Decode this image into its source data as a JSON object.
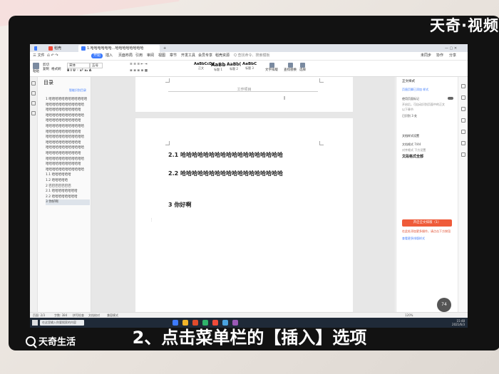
{
  "watermark": "天奇·视频",
  "caption": "2、点击菜单栏的【插入】选项",
  "logo_text": "天奇生活",
  "tabs": [
    {
      "label": "稻壳"
    },
    {
      "label": "1.哈哈哈哈哈哈...哈哈哈哈哈哈哈哈"
    }
  ],
  "menu": [
    "三 文件",
    "开始",
    "插入",
    "页面布局",
    "引用",
    "审阅",
    "视图",
    "章节",
    "开发工具",
    "会员专享",
    "稻壳资源",
    "Q 查找命令、搜索模板"
  ],
  "menu_right": [
    "未同步",
    "协作",
    "分享"
  ],
  "ribbon": {
    "paste": "粘贴",
    "cut": "剪切",
    "copy": "复制",
    "format_painter": "格式刷",
    "font": "宋体",
    "size": "五号",
    "styles": [
      {
        "sample": "AaBbCcDd",
        "name": "正文"
      },
      {
        "sample": "AaBb",
        "name": "标题 1"
      },
      {
        "sample": "AaBb(",
        "name": "标题 2"
      },
      {
        "sample": "AaBbC",
        "name": "标题 3"
      }
    ],
    "text_tools": "文字排版",
    "find_replace": "查找替换",
    "select": "选择"
  },
  "nav": {
    "title": "目录",
    "smart": "智能识别目录",
    "items": [
      "1 哈哈哈哈哈哈哈哈哈哈哈哈",
      "哈哈哈哈哈哈哈哈哈哈哈哈",
      "哈哈哈哈哈哈哈哈哈哈哈",
      "哈哈哈哈哈哈哈哈哈哈哈哈",
      "哈哈哈哈哈哈哈哈哈哈哈",
      "哈哈哈哈哈哈哈哈哈哈哈哈",
      "哈哈哈哈哈哈哈哈哈哈哈",
      "哈哈哈哈哈哈哈哈哈哈哈哈",
      "哈哈哈哈哈哈哈哈哈哈哈",
      "哈哈哈哈哈哈哈哈哈哈哈哈",
      "哈哈哈哈哈哈哈哈哈哈哈",
      "哈哈哈哈哈哈哈哈哈哈哈哈",
      "哈哈哈哈哈哈哈哈哈哈哈",
      "哈哈哈哈哈哈哈哈哈哈哈哈",
      "1.1 哈哈哈哈哈哈",
      "1.2 哈哈哈哈哈",
      "2 巴巴巴巴巴巴巴",
      "2.1 哈哈哈哈哈哈哈哈",
      "2.2 哈哈哈哈哈哈哈哈",
      "3 你好啊"
    ],
    "selected_index": 19
  },
  "document": {
    "header": "工作项目",
    "h21": "2.1 哈哈哈哈哈哈哈哈哈哈哈哈哈哈哈哈哈哈",
    "h22": "2.2 哈哈哈哈哈哈哈哈哈哈哈哈哈哈哈哈哈哈",
    "h3": "3 你好啊"
  },
  "right_panel": {
    "title": "正文样式",
    "link": "页眉页脚已添加 样式",
    "toggle_label": "使用页面标记",
    "desc1": "开启后，可自动识别页面中的正文",
    "desc2": "以下章节",
    "count": "已识别 3 处",
    "section": "文档样式设置",
    "format_title": "文档格式 7/44",
    "format_sub": "对齐格式 下方设置",
    "format_name": "文段格式全部",
    "button": "开启全文排版（1）",
    "tip": "在此处添加更多操作，请点击下方按钮",
    "more": "查看更多排版样式"
  },
  "status": {
    "page": "页面: 2/3",
    "words": "字数: 384",
    "spell": "拼写检查",
    "doc_check": "文档校对",
    "compat": "兼容模式",
    "zoom": "120%"
  },
  "zoom_badge": "74",
  "taskbar": {
    "search_placeholder": "在这里输入你要搜索的内容",
    "time": "15:48",
    "date": "2021/6/3"
  }
}
